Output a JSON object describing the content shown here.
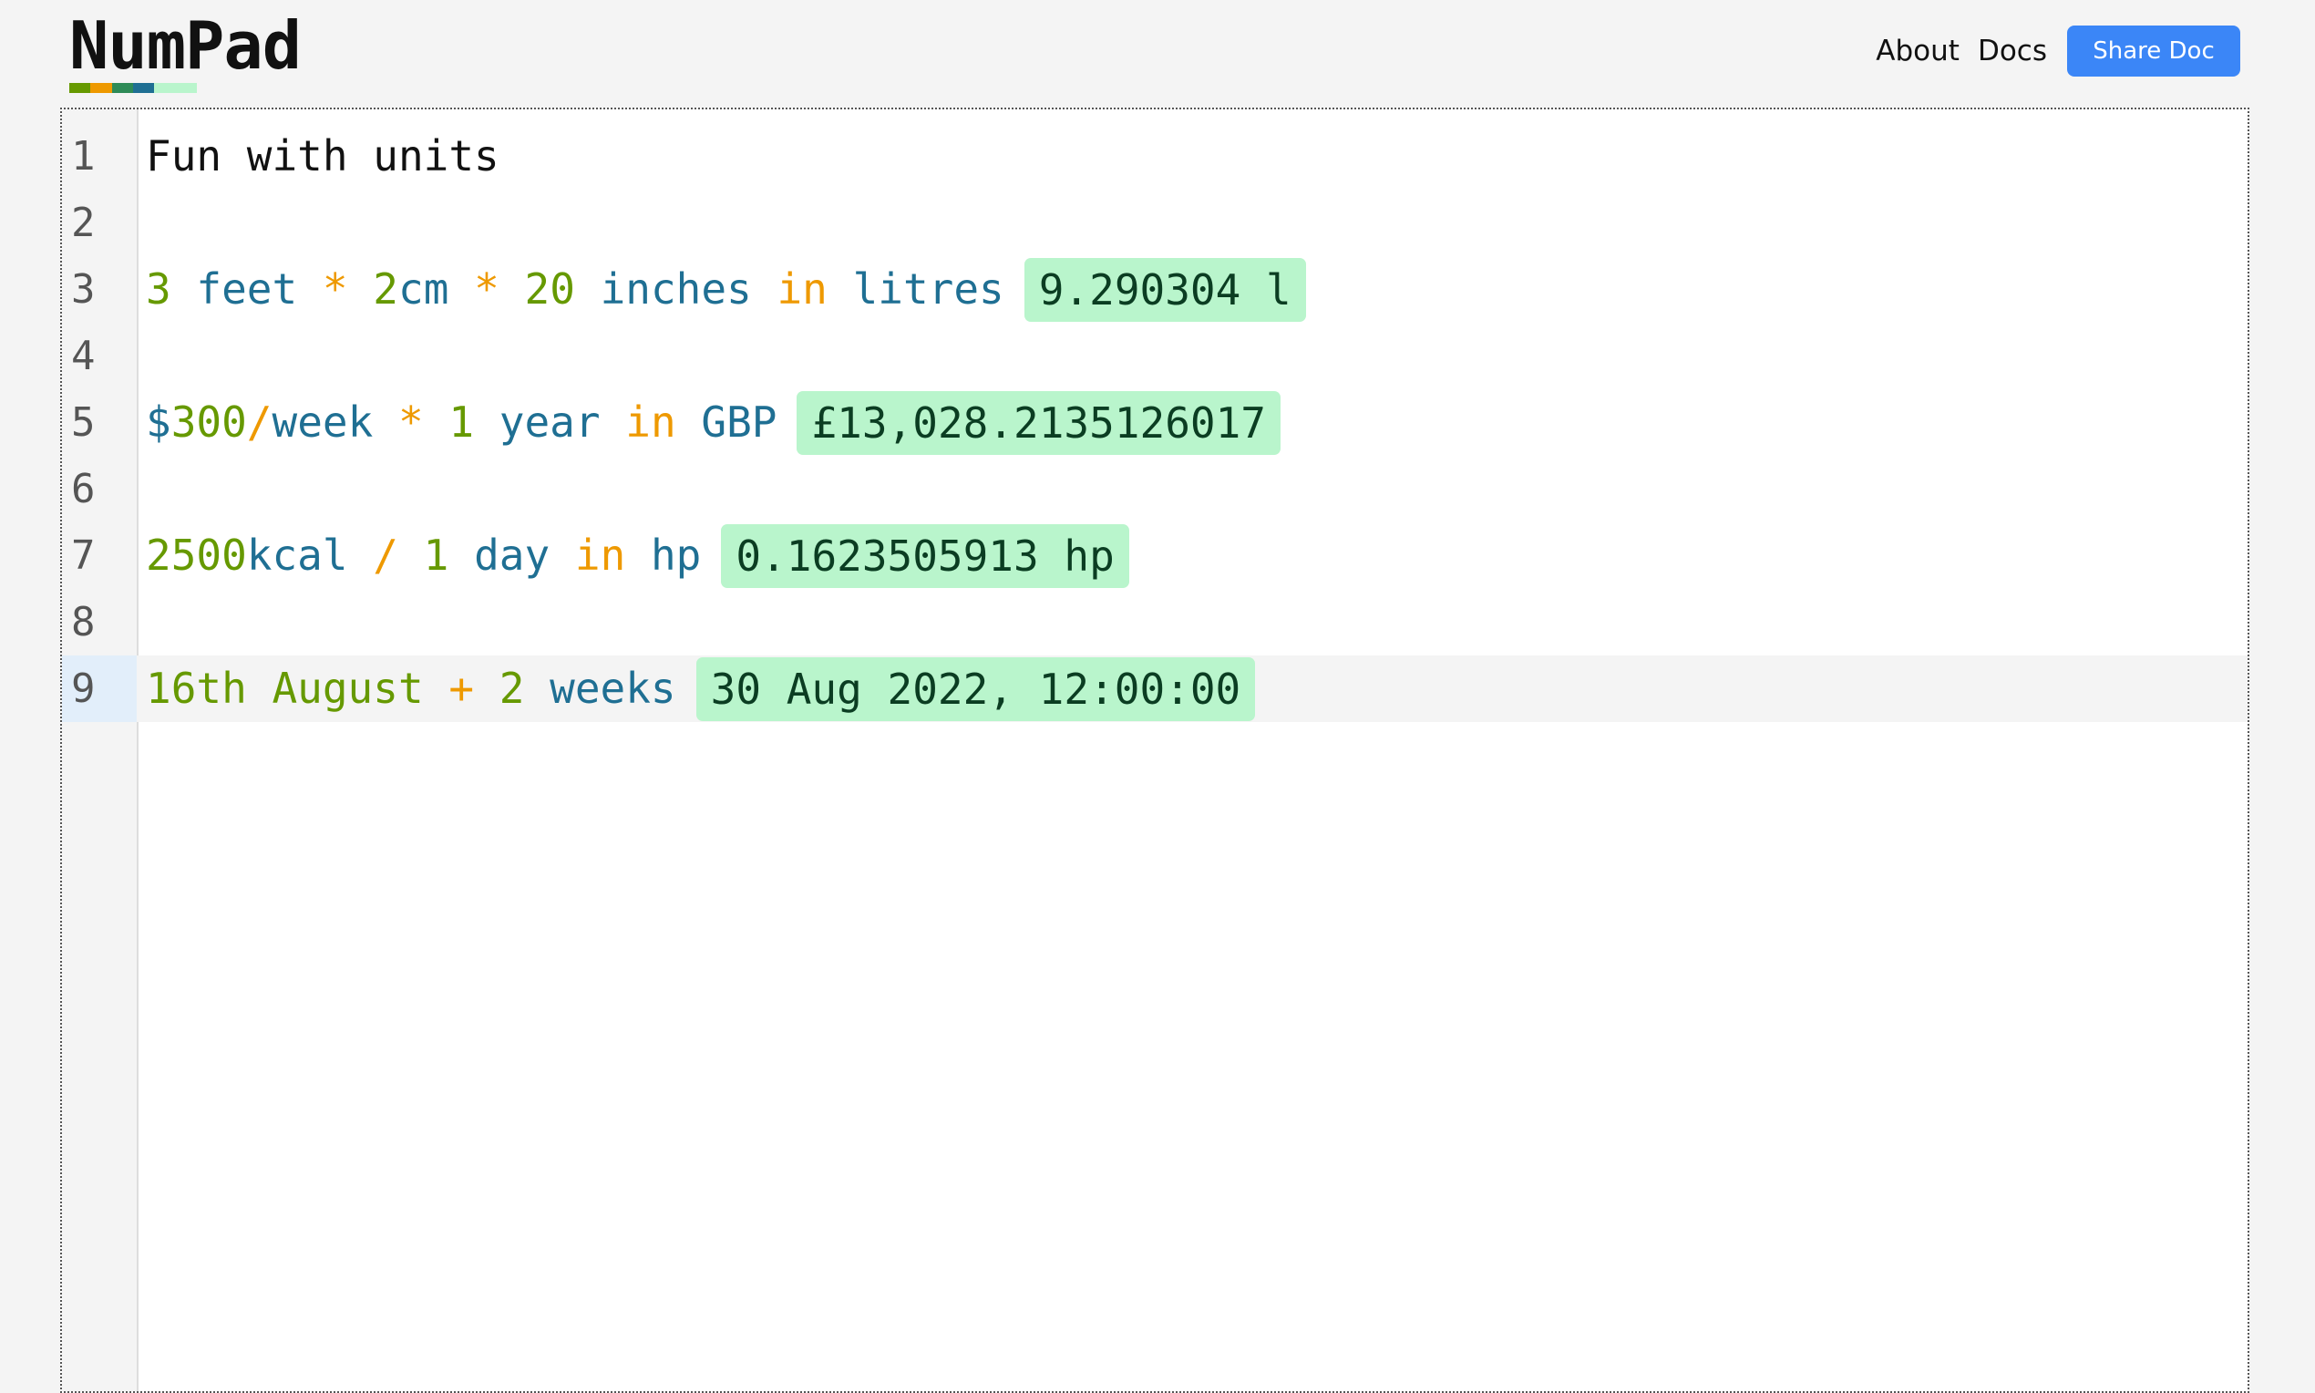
{
  "header": {
    "logo_text": "NumPad",
    "logo_bar_colors": [
      "#669900",
      "#ee9900",
      "#2e8b57",
      "#1f6f93",
      "#b9f5cc",
      "#b9f5cc"
    ],
    "nav_about": "About",
    "nav_docs": "Docs",
    "share_label": "Share Doc",
    "share_color": "#3b86f7"
  },
  "editor": {
    "active_line": 9,
    "result_bg": "#b9f5cc",
    "lines": [
      {
        "number": "1",
        "tokens": [
          {
            "text": "Fun with units",
            "type": "plain"
          }
        ],
        "result": ""
      },
      {
        "number": "2",
        "tokens": [],
        "result": ""
      },
      {
        "number": "3",
        "tokens": [
          {
            "text": "3",
            "type": "num"
          },
          {
            "text": " ",
            "type": "plain"
          },
          {
            "text": "feet",
            "type": "unit"
          },
          {
            "text": " ",
            "type": "plain"
          },
          {
            "text": "*",
            "type": "op"
          },
          {
            "text": " ",
            "type": "plain"
          },
          {
            "text": "2",
            "type": "num"
          },
          {
            "text": "cm",
            "type": "unit"
          },
          {
            "text": " ",
            "type": "plain"
          },
          {
            "text": "*",
            "type": "op"
          },
          {
            "text": " ",
            "type": "plain"
          },
          {
            "text": "20",
            "type": "num"
          },
          {
            "text": " ",
            "type": "plain"
          },
          {
            "text": "inches",
            "type": "unit"
          },
          {
            "text": " ",
            "type": "plain"
          },
          {
            "text": "in",
            "type": "op"
          },
          {
            "text": " ",
            "type": "plain"
          },
          {
            "text": "litres",
            "type": "unit"
          }
        ],
        "result": "9.290304 l"
      },
      {
        "number": "4",
        "tokens": [],
        "result": ""
      },
      {
        "number": "5",
        "tokens": [
          {
            "text": "$",
            "type": "unit"
          },
          {
            "text": "300",
            "type": "num"
          },
          {
            "text": "/",
            "type": "op"
          },
          {
            "text": "week",
            "type": "unit"
          },
          {
            "text": " ",
            "type": "plain"
          },
          {
            "text": "*",
            "type": "op"
          },
          {
            "text": " ",
            "type": "plain"
          },
          {
            "text": "1",
            "type": "num"
          },
          {
            "text": " ",
            "type": "plain"
          },
          {
            "text": "year",
            "type": "unit"
          },
          {
            "text": " ",
            "type": "plain"
          },
          {
            "text": "in",
            "type": "op"
          },
          {
            "text": " ",
            "type": "plain"
          },
          {
            "text": "GBP",
            "type": "unit"
          }
        ],
        "result": "£13,028.2135126017"
      },
      {
        "number": "6",
        "tokens": [],
        "result": ""
      },
      {
        "number": "7",
        "tokens": [
          {
            "text": "2500",
            "type": "num"
          },
          {
            "text": "kcal",
            "type": "unit"
          },
          {
            "text": " ",
            "type": "plain"
          },
          {
            "text": "/",
            "type": "op"
          },
          {
            "text": " ",
            "type": "plain"
          },
          {
            "text": "1",
            "type": "num"
          },
          {
            "text": " ",
            "type": "plain"
          },
          {
            "text": "day",
            "type": "unit"
          },
          {
            "text": " ",
            "type": "plain"
          },
          {
            "text": "in",
            "type": "op"
          },
          {
            "text": " ",
            "type": "plain"
          },
          {
            "text": "hp",
            "type": "unit"
          }
        ],
        "result": "0.1623505913 hp"
      },
      {
        "number": "8",
        "tokens": [],
        "result": ""
      },
      {
        "number": "9",
        "tokens": [
          {
            "text": "16th August",
            "type": "num"
          },
          {
            "text": " ",
            "type": "plain"
          },
          {
            "text": "+",
            "type": "op"
          },
          {
            "text": " ",
            "type": "plain"
          },
          {
            "text": "2",
            "type": "num"
          },
          {
            "text": " ",
            "type": "plain"
          },
          {
            "text": "weeks",
            "type": "unit"
          }
        ],
        "result": "30 Aug 2022, 12:00:00"
      }
    ]
  }
}
